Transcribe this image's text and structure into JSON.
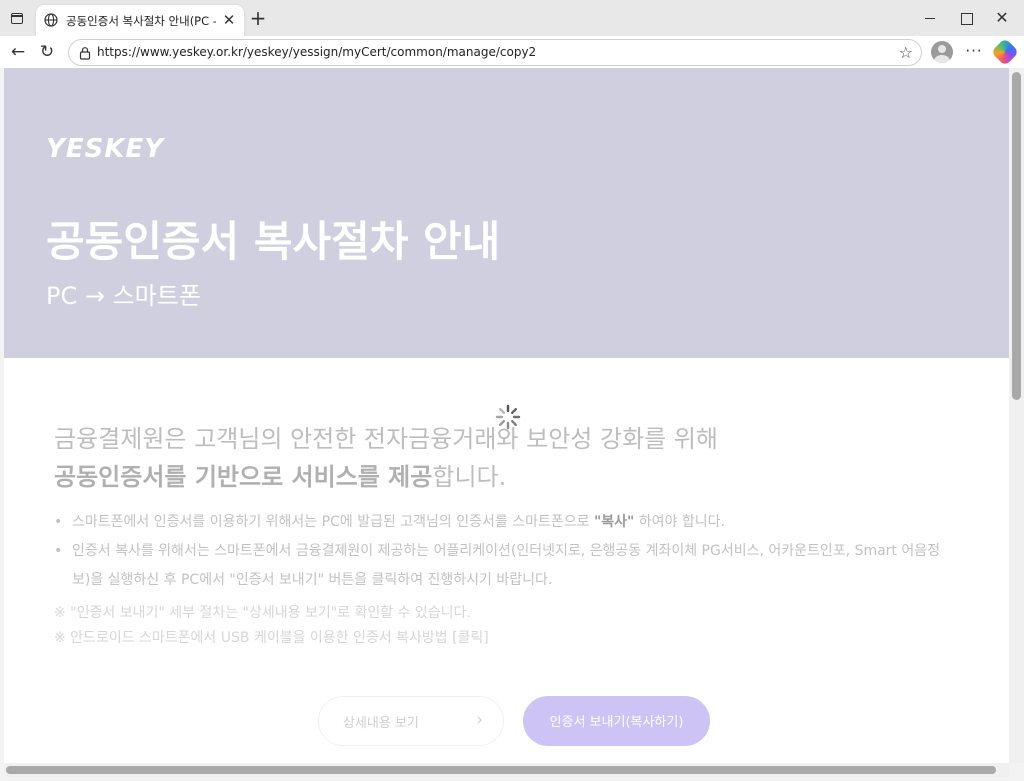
{
  "browser": {
    "tab_title": "공동인증서 복사절차 안내(PC - 스",
    "tab_close": "✕",
    "new_tab": "+",
    "window_close": "✕",
    "url": "https://www.yeskey.or.kr/yeskey/yessign/myCert/common/manage/copy2",
    "back": "←",
    "reload": "↻",
    "star": "☆",
    "menu": "···"
  },
  "hero": {
    "logo": "YESKEY",
    "title": "공동인증서 복사절차 안내",
    "subtitle": "PC → 스마트폰",
    "background": "#cfcfe0"
  },
  "intro": {
    "line1": "금융결제원은 고객님의 안전한 전자금융거래와 보안성 강화를 위해",
    "line2_strong": "공동인증서를 기반으로 서비스를 제공",
    "line2_rest": "합니다."
  },
  "bullets": [
    {
      "before": "스마트폰에서 인증서를 이용하기 위해서는 PC에 발급된 고객님의 인증서를 스마트폰으로 ",
      "em": "\"복사\"",
      "after": " 하여야 합니다."
    },
    {
      "text": "인증서 복사를 위해서는 스마트폰에서 금융결제원이 제공하는 어플리케이션(인터넷지로, 은행공동 계좌이체 PG서비스, 어카운트인포, Smart 어음정보)을 실행하신 후 PC에서 \"인증서 보내기\" 버튼을 클릭하여 진행하시기 바랍니다."
    }
  ],
  "notes": [
    "※ \"인증서 보내기\" 세부 절차는 \"상세내용 보기\"로 확인할 수 있습니다.",
    "※ 안드로이드 스마트폰에서 USB 케이블을 이용한 인증서 복사방법 [클릭]"
  ],
  "buttons": {
    "detail": "상세내용 보기",
    "detail_chevron": "›",
    "send": "인증서 보내기(복사하기)",
    "send_color": "#cdc4f5"
  }
}
